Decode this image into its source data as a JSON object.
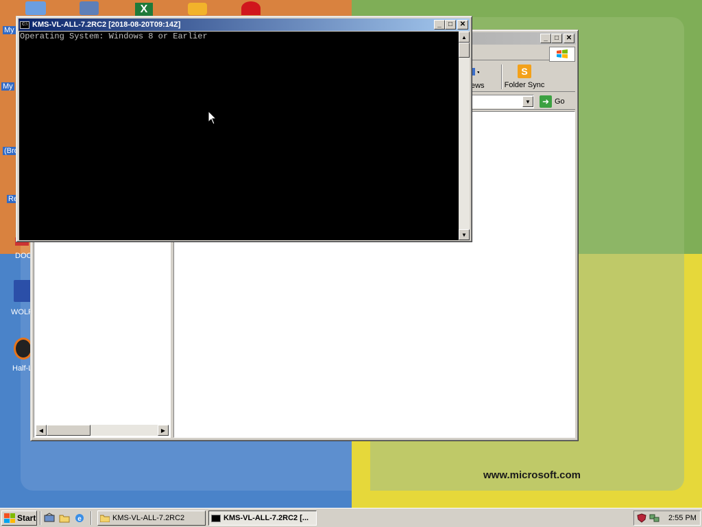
{
  "desktop": {
    "icons": [
      {
        "label": "My"
      },
      {
        "label": "My"
      },
      {
        "label": "(Bro"
      },
      {
        "label": "Re"
      },
      {
        "label": "DOC"
      },
      {
        "label": "WOLF"
      },
      {
        "label": "Half-L"
      }
    ],
    "wallpaper_url": "www.microsoft.com"
  },
  "console_window": {
    "title": "KMS-VL-ALL-7.2RC2 [2018-08-20T09:14Z]",
    "icon_text": "C:\\",
    "lines": [
      "Operating System: Windows 8 or Earlier"
    ]
  },
  "explorer_window": {
    "toolbar": {
      "views_label": "ews",
      "foldersync_label": "Folder Sync"
    },
    "address": {
      "value": "",
      "go_label": "Go"
    }
  },
  "taskbar": {
    "start_label": "Start",
    "tasks": [
      {
        "label": "KMS-VL-ALL-7.2RC2"
      },
      {
        "label": "KMS-VL-ALL-7.2RC2 [..."
      }
    ],
    "clock": "2:55 PM"
  },
  "colors": {
    "title_active": "#0a246a",
    "title_inactive": "#808080",
    "console_bg": "#000000",
    "console_fg": "#c0c0c0"
  }
}
